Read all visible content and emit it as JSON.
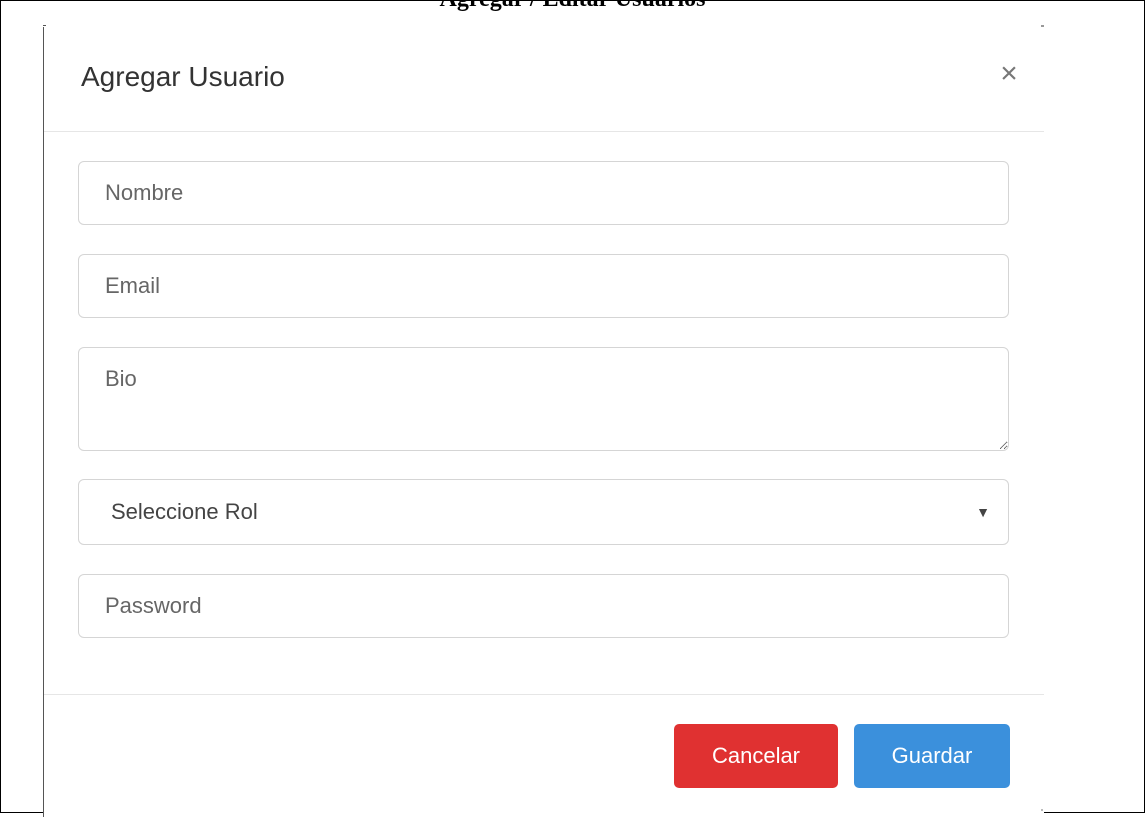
{
  "document": {
    "caption": "Agregar / Editar Usuarios"
  },
  "modal": {
    "title": "Agregar Usuario",
    "close_label": "×"
  },
  "form": {
    "name_placeholder": "Nombre",
    "email_placeholder": "Email",
    "bio_placeholder": "Bio",
    "role_select": {
      "selected_value": "Seleccione Rol",
      "arrow": "▼"
    },
    "password_placeholder": "Password"
  },
  "footer": {
    "cancel_label": "Cancelar",
    "save_label": "Guardar"
  },
  "colors": {
    "cancel_button": "#e03131",
    "save_button": "#3b90dc",
    "border": "#d5d5d5"
  },
  "icons": {
    "close": "close-icon",
    "select_arrow": "chevron-down-icon",
    "resize_handle": "resize-grip-icon"
  }
}
